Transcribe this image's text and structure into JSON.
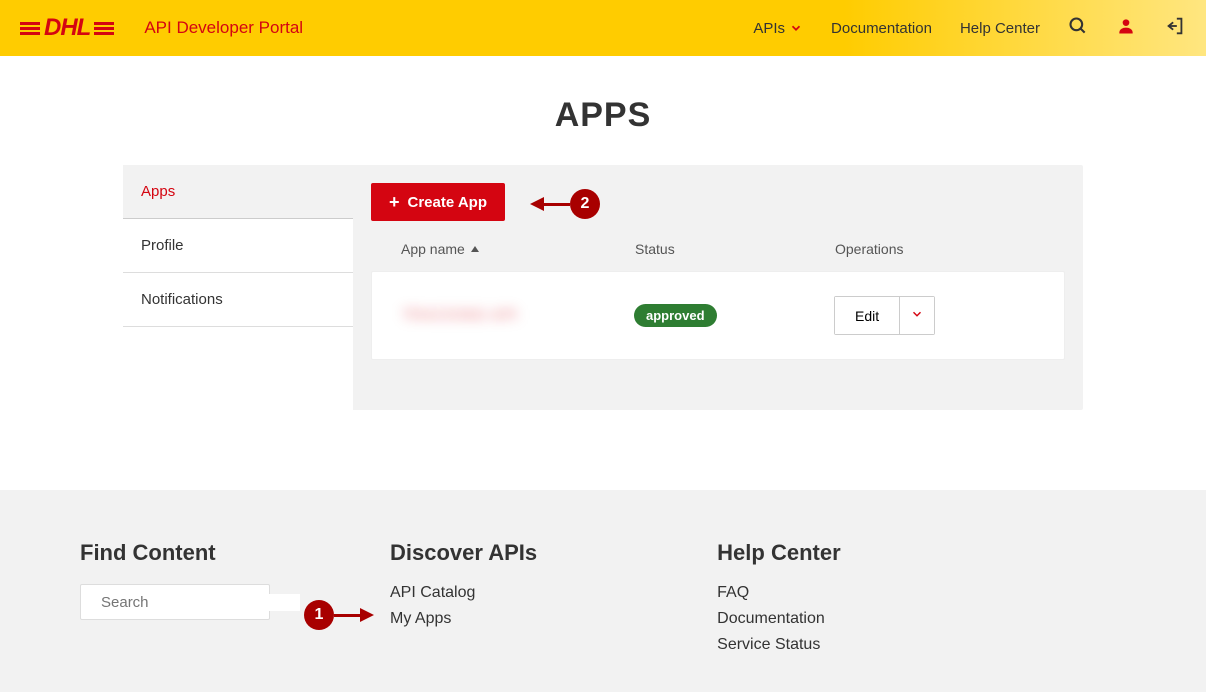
{
  "header": {
    "portal_title": "API Developer Portal",
    "nav": {
      "apis": "APIs",
      "documentation": "Documentation",
      "help_center": "Help Center"
    }
  },
  "page": {
    "title": "APPS"
  },
  "sidebar": {
    "items": [
      {
        "label": "Apps"
      },
      {
        "label": "Profile"
      },
      {
        "label": "Notifications"
      }
    ]
  },
  "content": {
    "create_label": "Create App",
    "columns": {
      "app_name": "App name",
      "status": "Status",
      "operations": "Operations"
    },
    "rows": [
      {
        "name": "TRACKING API",
        "status": "approved",
        "edit": "Edit"
      }
    ]
  },
  "annotations": {
    "step1": "1",
    "step2": "2"
  },
  "footer": {
    "find_content": {
      "title": "Find Content",
      "search_placeholder": "Search"
    },
    "discover": {
      "title": "Discover APIs",
      "links": [
        {
          "label": "API Catalog"
        },
        {
          "label": "My Apps"
        }
      ]
    },
    "help": {
      "title": "Help Center",
      "links": [
        {
          "label": "FAQ"
        },
        {
          "label": "Documentation"
        },
        {
          "label": "Service Status"
        }
      ]
    }
  }
}
